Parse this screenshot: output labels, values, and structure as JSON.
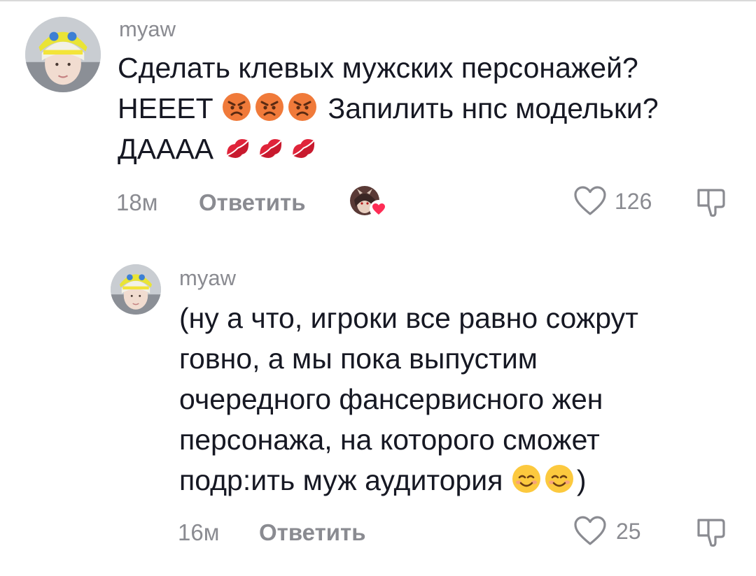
{
  "comments": [
    {
      "username": "myaw",
      "lines": [
        {
          "before": "Сделать клевых мужских персонажей?",
          "emoji": [],
          "after": ""
        },
        {
          "before": "НЕЕЕТ ",
          "emoji": [
            "angry-face",
            "angry-face",
            "angry-face"
          ],
          "after": " Запилить нпс модельки?"
        },
        {
          "before": "ДАААА ",
          "emoji": [
            "kiss-mark",
            "kiss-mark",
            "kiss-mark"
          ],
          "after": ""
        }
      ],
      "time": "18м",
      "reply_label": "Ответить",
      "likes": "126",
      "liked_by_creator": true
    },
    {
      "username": "myaw",
      "lines": [
        {
          "before": "(ну а что, игроки все равно сожрут",
          "emoji": [],
          "after": ""
        },
        {
          "before": "говно, а мы пока выпустим",
          "emoji": [],
          "after": ""
        },
        {
          "before": "очередного фансервисного жен",
          "emoji": [],
          "after": ""
        },
        {
          "before": "персонажа, на которого сможет",
          "emoji": [],
          "after": ""
        },
        {
          "before": "подр:ить муж аудитория ",
          "emoji": [
            "smiling-face",
            "smiling-face"
          ],
          "after": ")"
        }
      ],
      "time": "16м",
      "reply_label": "Ответить",
      "likes": "25",
      "liked_by_creator": false
    }
  ],
  "colors": {
    "text": "#161823",
    "secondary": "#8a8b91",
    "like_heart": "#fe2c55"
  }
}
